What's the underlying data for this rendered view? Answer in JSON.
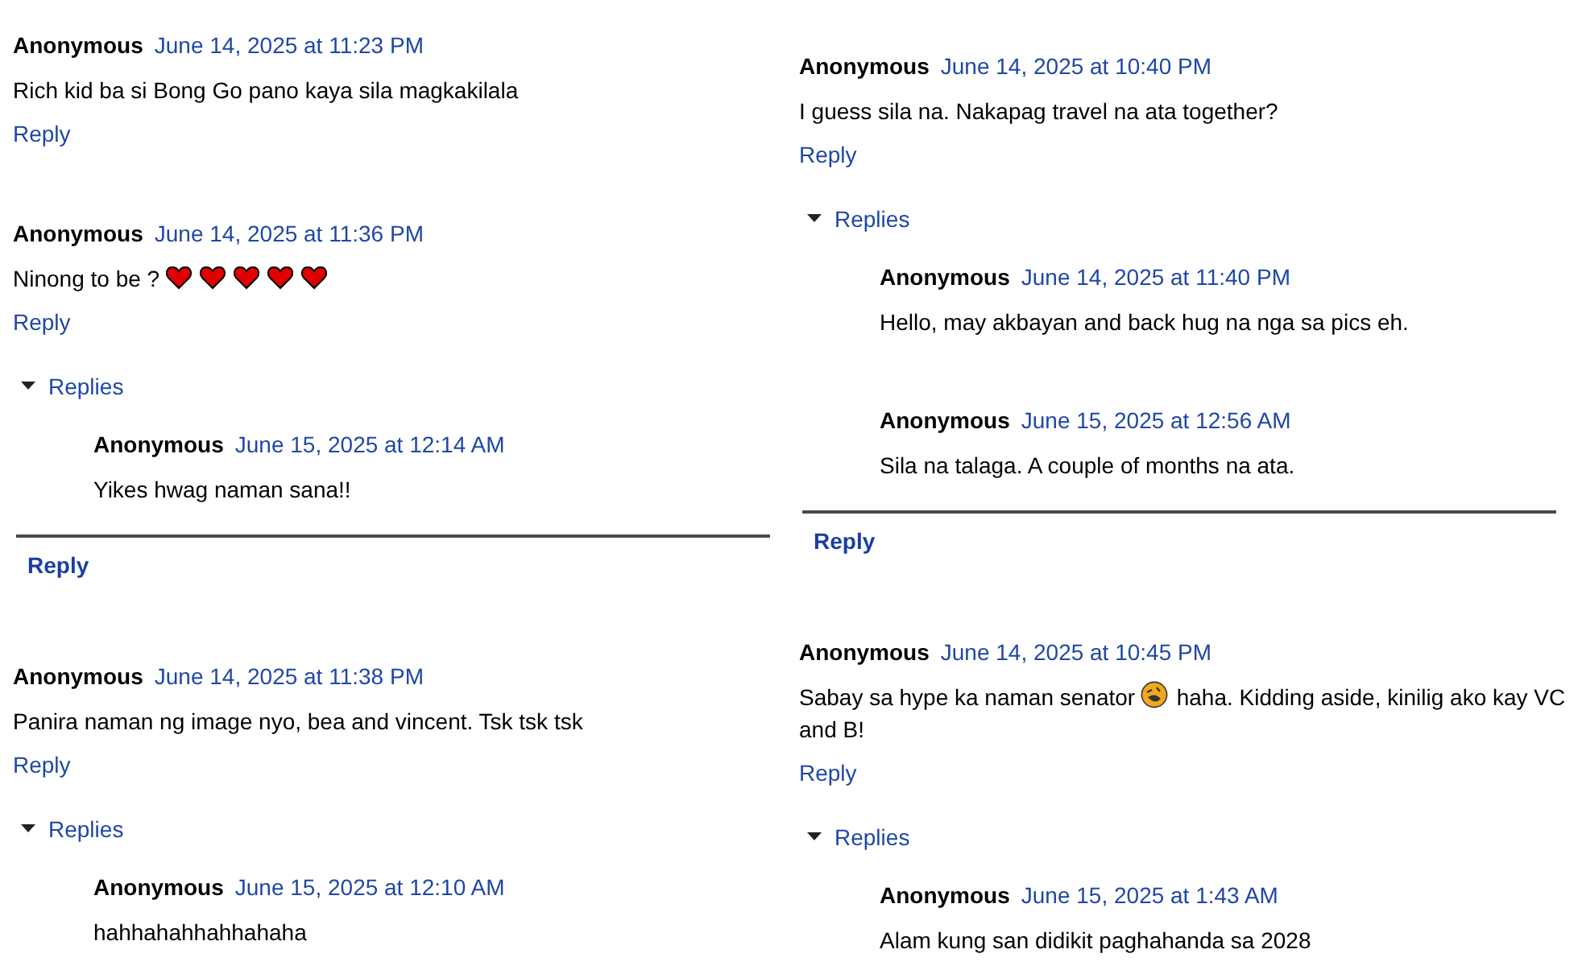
{
  "columns": [
    {
      "comments": [
        {
          "author": "Anonymous",
          "date": "June 14, 2025 at 11:23 PM",
          "body": [
            {
              "kind": "text",
              "text": "Rich kid ba si Bong Go pano kaya sila magkakilala"
            }
          ],
          "reply": "Reply"
        },
        {
          "author": "Anonymous",
          "date": "June 14, 2025 at 11:36 PM",
          "body": [
            {
              "kind": "text",
              "text": "Ninong to be ?"
            },
            {
              "kind": "heart-emoji"
            },
            {
              "kind": "heart-emoji"
            },
            {
              "kind": "heart-emoji"
            },
            {
              "kind": "heart-emoji"
            },
            {
              "kind": "heart-emoji"
            }
          ],
          "reply": "Reply",
          "replies": {
            "label": "Replies",
            "expanded": true,
            "items": [
              {
                "author": "Anonymous",
                "date": "June 15, 2025 at 12:14 AM",
                "body": [
                  {
                    "kind": "text",
                    "text": "Yikes hwag naman sana!!"
                  }
                ]
              }
            ],
            "reply": "Reply"
          }
        },
        {
          "author": "Anonymous",
          "date": "June 14, 2025 at 11:38 PM",
          "body": [
            {
              "kind": "text",
              "text": "Panira naman ng image nyo, bea and vincent. Tsk tsk tsk"
            }
          ],
          "reply": "Reply",
          "replies": {
            "label": "Replies",
            "expanded": true,
            "items": [
              {
                "author": "Anonymous",
                "date": "June 15, 2025 at 12:10 AM",
                "body": [
                  {
                    "kind": "text",
                    "text": "hahhahahhahhahaha"
                  }
                ]
              }
            ]
          }
        }
      ]
    },
    {
      "comments": [
        {
          "author": "Anonymous",
          "date": "June 14, 2025 at 10:40 PM",
          "body": [
            {
              "kind": "text",
              "text": "I guess sila na. Nakapag travel na ata together?"
            }
          ],
          "reply": "Reply",
          "replies": {
            "label": "Replies",
            "expanded": true,
            "items": [
              {
                "author": "Anonymous",
                "date": "June 14, 2025 at 11:40 PM",
                "body": [
                  {
                    "kind": "text",
                    "text": "Hello, may akbayan and back hug na nga sa pics eh."
                  }
                ]
              },
              {
                "author": "Anonymous",
                "date": "June 15, 2025 at 12:56 AM",
                "body": [
                  {
                    "kind": "text",
                    "text": "Sila na talaga. A couple of months na ata."
                  }
                ]
              }
            ],
            "reply": "Reply"
          }
        },
        {
          "author": "Anonymous",
          "date": "June 14, 2025 at 10:45 PM",
          "body": [
            {
              "kind": "text",
              "text": "Sabay sa hype ka naman senator"
            },
            {
              "kind": "laughing-emoji"
            },
            {
              "kind": "text",
              "text": "haha. Kidding aside, kinilig ako kay VC"
            },
            {
              "kind": "text",
              "text": "and B!"
            }
          ],
          "reply": "Reply",
          "replies": {
            "label": "Replies",
            "expanded": true,
            "items": [
              {
                "author": "Anonymous",
                "date": "June 15, 2025 at 1:43 AM",
                "body": [
                  {
                    "kind": "text",
                    "text": "Alam kung san didikit paghahanda sa 2028"
                  }
                ]
              }
            ]
          }
        }
      ]
    }
  ]
}
